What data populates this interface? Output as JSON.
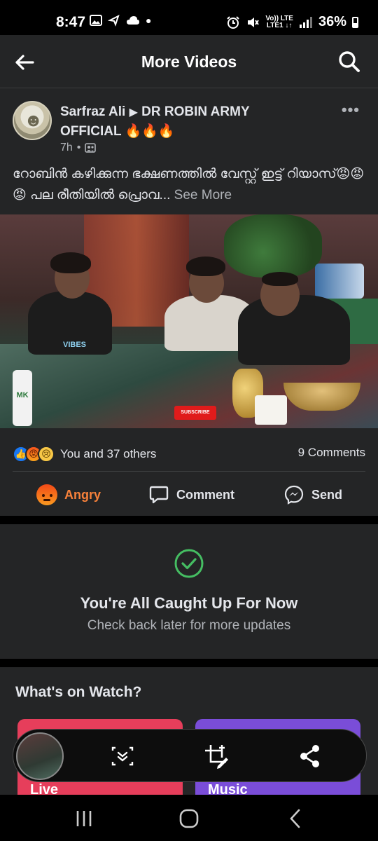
{
  "status_bar": {
    "time": "8:47",
    "left_icons": [
      "gallery-icon",
      "navigation-icon",
      "cloud-icon",
      "dot-icon"
    ],
    "right_icons": [
      "alarm-icon",
      "mute-icon",
      "volte-icon",
      "signal-icon"
    ],
    "volte_top": "Vo)) LTE",
    "volte_bottom": "LTE1 ↓↑",
    "battery_percent": "36%"
  },
  "app_bar": {
    "title": "More Videos",
    "back_icon": "back-arrow-icon",
    "search_icon": "search-icon"
  },
  "post": {
    "author": "Sarfraz Ali",
    "arrow": "▶",
    "group": "DR ROBIN ARMY OFFICIAL 🔥🔥🔥",
    "time": "7h",
    "separator": "•",
    "audience_icon": "group-icon",
    "caption": "റോബിൻ കഴിക്കുന്ന ഭക്ഷണത്തിൽ വേസ്റ്റ് ഇട്ട് റിയാസ്😡😡😡   പല രീതിയിൽ പ്രൊവ...",
    "see_more": "See More",
    "video": {
      "watermark": "VIBES",
      "bottle_label": "MK",
      "subscribe_label": "SUBSCRIBE"
    },
    "reaction_icons": [
      "like-icon",
      "angry-icon",
      "sad-icon"
    ],
    "reactions_text": "You and 37 others",
    "comments_text": "9 Comments",
    "actions": {
      "angry": "Angry",
      "comment": "Comment",
      "send": "Send"
    },
    "accent_angry": "#f7813a"
  },
  "caught_up": {
    "title": "You're All Caught Up For Now",
    "subtitle": "Check back later for more updates",
    "icon": "check-circle-icon",
    "icon_color": "#45bd62"
  },
  "watch": {
    "title": "What's on Watch?",
    "cards": [
      {
        "label": "Live",
        "color": "#e63e5b"
      },
      {
        "label": "Music",
        "color": "#7a4dd8"
      }
    ]
  },
  "screenshot_toolbar": {
    "buttons": [
      "scroll-capture-icon",
      "crop-edit-icon",
      "share-icon"
    ]
  },
  "nav_bar": {
    "buttons": [
      "recents-icon",
      "home-icon",
      "back-icon"
    ]
  }
}
